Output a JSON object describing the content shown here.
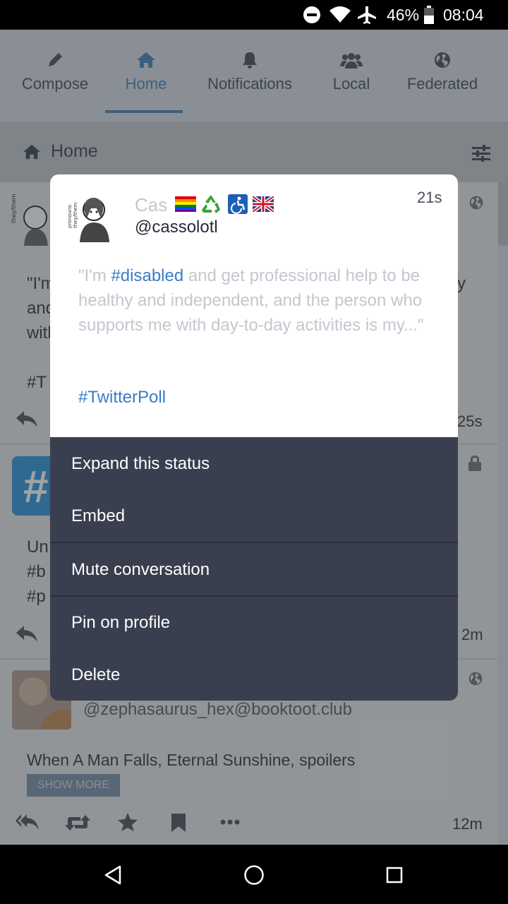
{
  "status_bar": {
    "battery": "46%",
    "time": "08:04",
    "icons": [
      "do-not-disturb-icon",
      "wifi-icon",
      "airplane-mode-icon",
      "battery-icon"
    ]
  },
  "tabs": [
    {
      "label": "Compose",
      "icon": "pencil-icon"
    },
    {
      "label": "Home",
      "icon": "home-icon",
      "active": true
    },
    {
      "label": "Notifications",
      "icon": "bell-icon"
    },
    {
      "label": "Local",
      "icon": "users-icon"
    },
    {
      "label": "Federated",
      "icon": "globe-icon"
    }
  ],
  "column_header": {
    "title": "Home",
    "settings_icon": "sliders-icon"
  },
  "feed": {
    "status1": {
      "time": "25s",
      "text_frag": [
        "\"I'm",
        "and",
        "with",
        "#T"
      ],
      "right_frag": "y"
    },
    "status2": {
      "time": "2m",
      "text_frag": [
        "Un",
        "#b",
        "#p"
      ]
    },
    "status3": {
      "handle": "@zephasaurus_hex@booktoot.club",
      "content_warning": "When A Man Falls, Eternal Sunshine, spoilers",
      "show_more": "SHOW MORE",
      "time": "12m"
    }
  },
  "popup": {
    "status": {
      "display_name": "Cas",
      "handle": "@cassolotl",
      "time": "21s",
      "avatar_text": "pronouns: they/them",
      "emoji": [
        "rainbow-flag",
        "recycling-symbol",
        "wheelchair-symbol",
        "uk-flag"
      ],
      "text_before": "\"I'm ",
      "hashtag1": "#disabled",
      "text_after": " and get professional help to be healthy and independent, and the person who supports me with day-to-day activities is my...\"",
      "hashtag2": "#TwitterPoll"
    },
    "menu": {
      "expand": "Expand this status",
      "embed": "Embed",
      "mute": "Mute conversation",
      "pin": "Pin on profile",
      "delete": "Delete"
    }
  },
  "colors": {
    "accent": "#5b95c6",
    "menu_bg": "#3a3f4f",
    "hashtag": "#3a7cc6",
    "underlay": "#d9e1e8"
  }
}
